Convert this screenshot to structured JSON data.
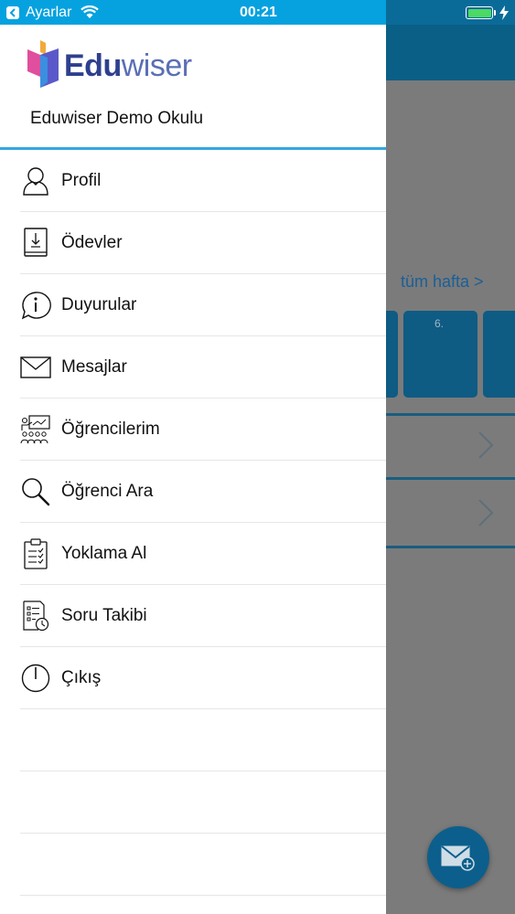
{
  "status_bar": {
    "carrier": "Ayarlar",
    "time": "00:21"
  },
  "brand": {
    "logo_part1": "Edu",
    "logo_part2": "wiser",
    "school_name": "Eduwiser Demo Okulu",
    "colors": {
      "accent": "#35a6de",
      "status_bar": "#05a2df",
      "logo_dark": "#2f3f8f"
    }
  },
  "menu": {
    "items": [
      {
        "label": "Profil",
        "icon": "user-icon"
      },
      {
        "label": "Ödevler",
        "icon": "homework-icon"
      },
      {
        "label": "Duyurular",
        "icon": "info-bubble-icon"
      },
      {
        "label": "Mesajlar",
        "icon": "envelope-icon"
      },
      {
        "label": "Öğrencilerim",
        "icon": "classroom-icon"
      },
      {
        "label": "Öğrenci Ara",
        "icon": "search-icon"
      },
      {
        "label": "Yoklama Al",
        "icon": "clipboard-check-icon"
      },
      {
        "label": "Soru Takibi",
        "icon": "question-tracking-icon"
      },
      {
        "label": "Çıkış",
        "icon": "power-icon"
      }
    ]
  },
  "background": {
    "week_link": "tüm hafta >",
    "tile_number": "6."
  }
}
